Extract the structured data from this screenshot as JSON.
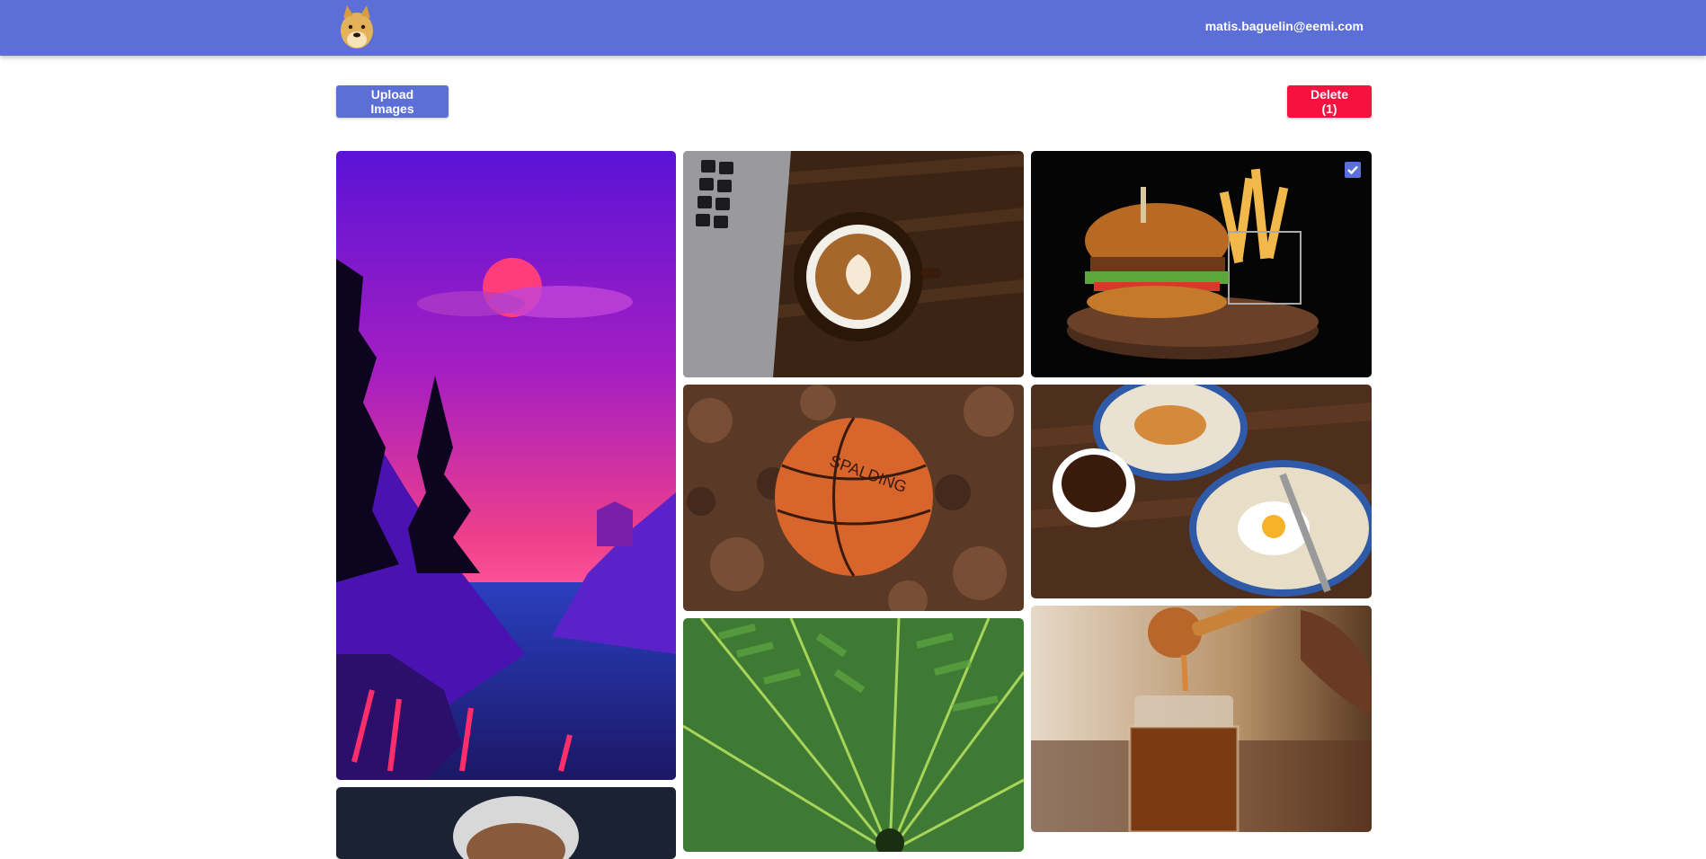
{
  "header": {
    "logo_icon": "doge-logo-icon",
    "user_email": "matis.baguelin@eemi.com",
    "bar_color": "#5b6fd6"
  },
  "toolbar": {
    "upload_label": "Upload Images",
    "delete_label": "Delete (1)",
    "delete_color": "#f7113f"
  },
  "gallery": {
    "images": [
      {
        "subject": "sunset-landscape-illustration",
        "selected": false
      },
      {
        "subject": "latte-and-laptop",
        "selected": false
      },
      {
        "subject": "burger-and-fries",
        "selected": true
      },
      {
        "subject": "basketball-in-leaves",
        "selected": false
      },
      {
        "subject": "breakfast-plates",
        "selected": false
      },
      {
        "subject": "fern-leaves",
        "selected": false
      },
      {
        "subject": "honey-jar",
        "selected": false
      },
      {
        "subject": "portrait-partial",
        "selected": false
      }
    ]
  }
}
